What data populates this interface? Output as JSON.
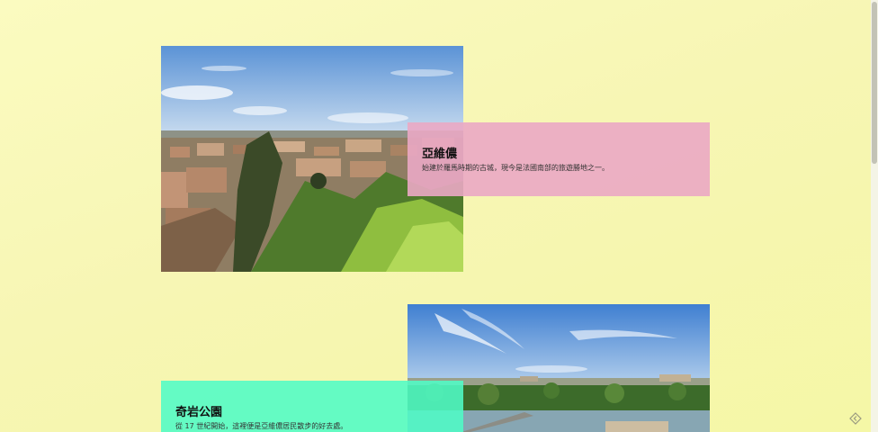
{
  "sections": [
    {
      "title": "亞維儂",
      "description": "始建於羅馬時期的古城，現今是法國南部的旅遊勝地之一。",
      "photo_icon": "avignon-rooftops-photo"
    },
    {
      "title": "奇岩公園",
      "description": "從 17 世紀開始，這裡便是亞維儂居民散步的好去處。",
      "photo_icon": "river-landscape-photo"
    }
  ],
  "colors": {
    "background_top": "#fbfbc0",
    "background_bottom": "#f5f7a6",
    "card_pink": "#eaa8c4",
    "card_mint": "#50fcc6"
  },
  "corner_icon": "diamond-nav-icon"
}
